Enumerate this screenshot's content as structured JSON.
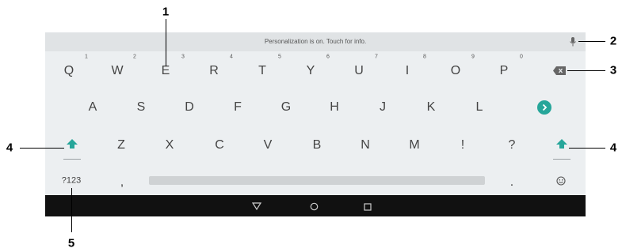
{
  "suggestion_bar": {
    "text": "Personalization is on. Touch for info."
  },
  "row1": [
    {
      "label": "Q",
      "hint": "1"
    },
    {
      "label": "W",
      "hint": "2"
    },
    {
      "label": "E",
      "hint": "3"
    },
    {
      "label": "R",
      "hint": "4"
    },
    {
      "label": "T",
      "hint": "5"
    },
    {
      "label": "Y",
      "hint": "6"
    },
    {
      "label": "U",
      "hint": "7"
    },
    {
      "label": "I",
      "hint": "8"
    },
    {
      "label": "O",
      "hint": "9"
    },
    {
      "label": "P",
      "hint": "0"
    }
  ],
  "row2": [
    "A",
    "S",
    "D",
    "F",
    "G",
    "H",
    "J",
    "K",
    "L"
  ],
  "row3": [
    "Z",
    "X",
    "C",
    "V",
    "B",
    "N",
    "M",
    "!",
    "?"
  ],
  "row4": {
    "symbols": "?123",
    "comma": ",",
    "period": "."
  },
  "callouts": [
    "1",
    "2",
    "3",
    "4",
    "4",
    "5"
  ],
  "icons": {
    "mic": "microphone-icon",
    "backspace": "backspace-icon",
    "enter": "enter-icon",
    "shift": "shift-icon",
    "emoji": "emoji-icon",
    "back": "back-icon",
    "home": "home-icon",
    "recents": "recents-icon"
  },
  "colors": {
    "accent": "#26a69a",
    "keyboard_bg": "#eceff1",
    "navbar": "#111111"
  }
}
